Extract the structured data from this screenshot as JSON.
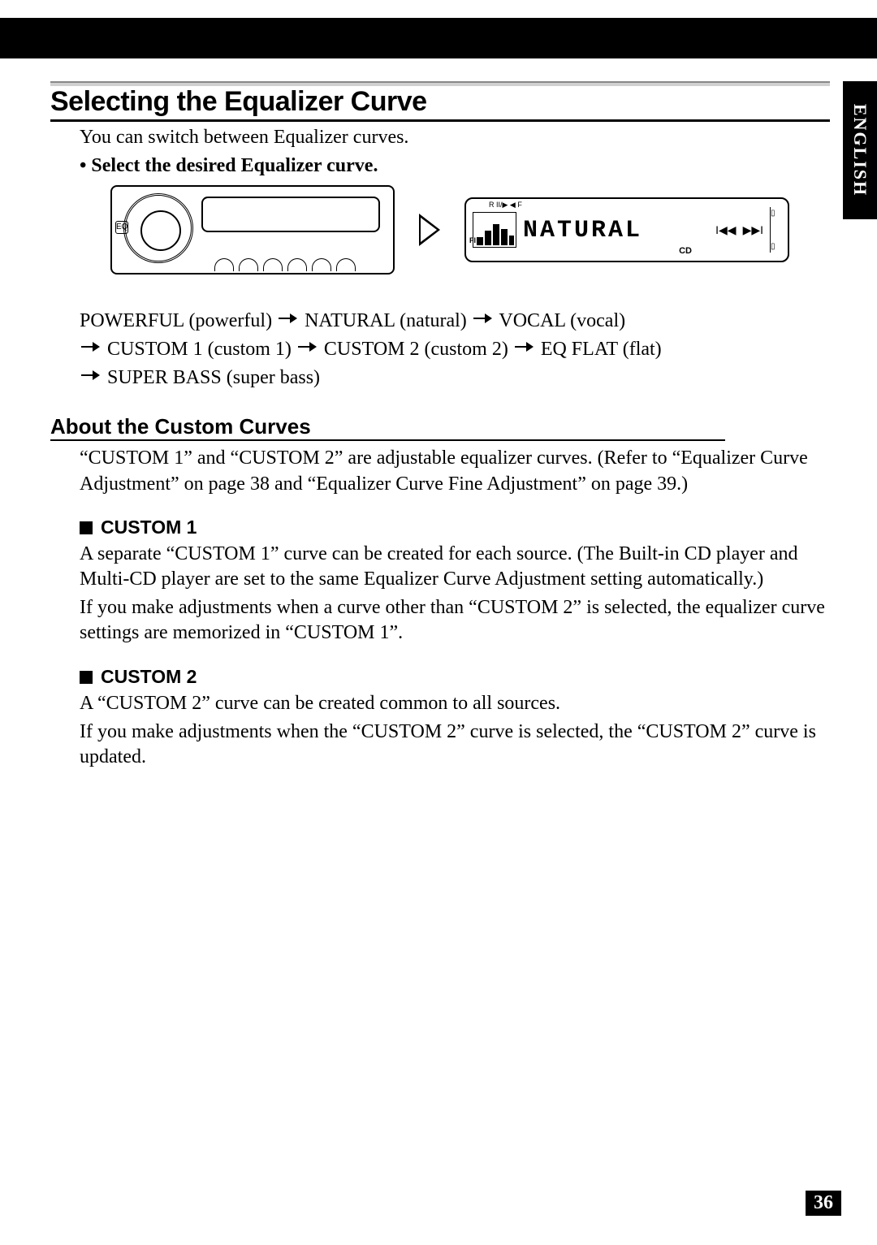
{
  "side_tab": "ENGLISH",
  "page_number": "36",
  "h1": "Selecting the Equalizer Curve",
  "intro": "You can switch between Equalizer curves.",
  "bullet": "Select the desired Equalizer curve.",
  "unit": {
    "eq_badge": "EQ"
  },
  "display": {
    "fi_label": "FI",
    "top_icons": "R II/▶ ◀ F",
    "lcd_text": "NATURAL",
    "cd_label": "CD",
    "prev_icon": "I◀◀",
    "next_icon": "▶▶I"
  },
  "seq": {
    "s1": "POWERFUL (powerful)",
    "s2": "NATURAL (natural)",
    "s3": "VOCAL (vocal)",
    "s4": "CUSTOM 1 (custom 1)",
    "s5": "CUSTOM 2 (custom 2)",
    "s6": "EQ FLAT (flat)",
    "s7": "SUPER BASS (super bass)"
  },
  "h2": "About the Custom Curves",
  "about_para": "“CUSTOM 1” and “CUSTOM 2” are adjustable equalizer curves. (Refer to “Equalizer Curve Adjustment” on page 38 and “Equalizer Curve Fine Adjustment” on page 39.)",
  "custom1_head": "CUSTOM 1",
  "custom1_p1": "A separate “CUSTOM 1” curve can be created for each source. (The Built-in CD player and Multi-CD player are set to the same Equalizer Curve Adjustment setting automatically.)",
  "custom1_p2": "If you make adjustments when a curve other than “CUSTOM 2” is selected, the equalizer curve settings are memorized in “CUSTOM 1”.",
  "custom2_head": "CUSTOM 2",
  "custom2_p1": "A “CUSTOM 2” curve can be created common to all sources.",
  "custom2_p2": "If you make adjustments when the “CUSTOM 2” curve is selected, the “CUSTOM 2” curve is updated."
}
